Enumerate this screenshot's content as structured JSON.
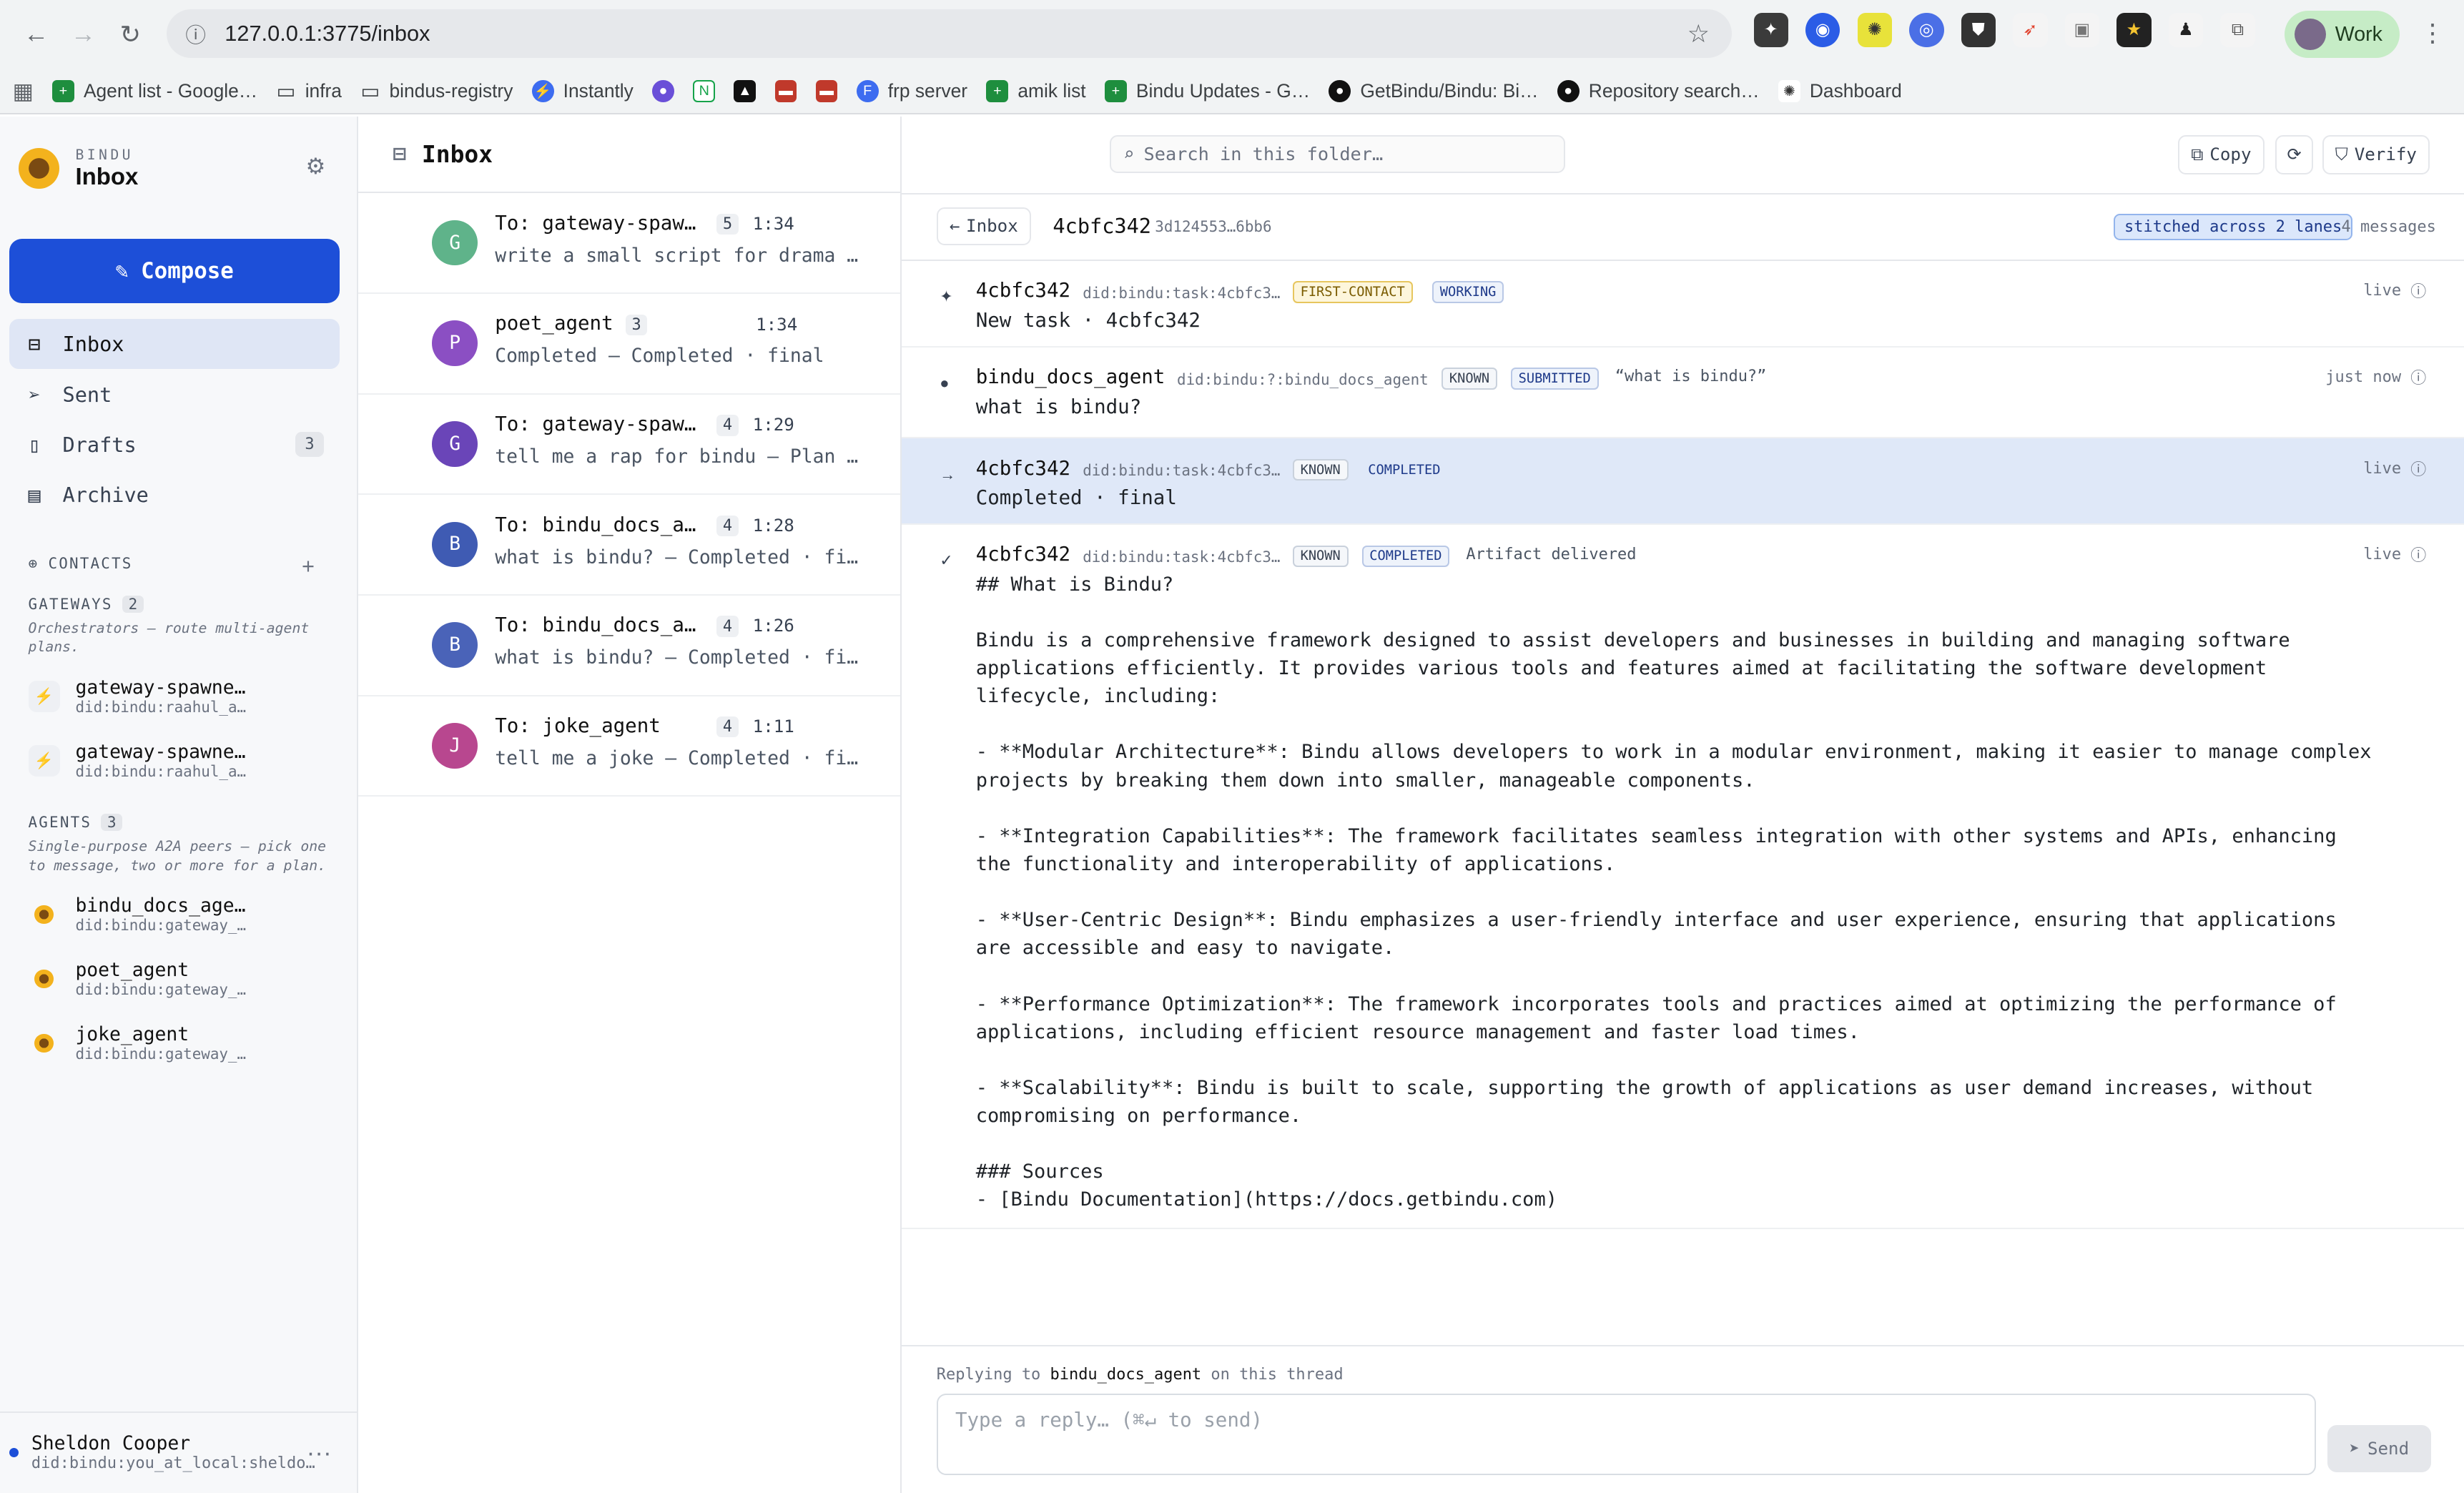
{
  "browser": {
    "url": "127.0.0.1:3775/inbox",
    "profile": "Work",
    "bookmarks": [
      "Agent list - Google…",
      "infra",
      "bindus-registry",
      "Instantly",
      "",
      "",
      "",
      "",
      "",
      "frp server",
      "amik list",
      "Bindu Updates - G…",
      "GetBindu/Bindu: Bi…",
      "Repository search…",
      "Dashboard"
    ]
  },
  "sidebar": {
    "brand_small": "BINDU",
    "brand_big": "Inbox",
    "compose": "Compose",
    "folders": [
      {
        "label": "Inbox",
        "count": ""
      },
      {
        "label": "Sent",
        "count": ""
      },
      {
        "label": "Drafts",
        "count": "3"
      },
      {
        "label": "Archive",
        "count": ""
      }
    ],
    "contacts_label": "CONTACTS",
    "gateways_label": "GATEWAYS",
    "gateways_count": "2",
    "gateways_hint": "Orchestrators — route multi-agent plans.",
    "gateways": [
      {
        "name": "gateway-spawne…",
        "did": "did:bindu:raahul_a…"
      },
      {
        "name": "gateway-spawne…",
        "did": "did:bindu:raahul_a…"
      }
    ],
    "agents_label": "AGENTS",
    "agents_count": "3",
    "agents_hint": "Single-purpose A2A peers — pick one to message, two or more for a plan.",
    "agents": [
      {
        "name": "bindu_docs_age…",
        "did": "did:bindu:gateway_…"
      },
      {
        "name": "poet_agent",
        "did": "did:bindu:gateway_…"
      },
      {
        "name": "joke_agent",
        "did": "did:bindu:gateway_…"
      }
    ],
    "user": {
      "name": "Sheldon Cooper",
      "did": "did:bindu:you_at_local:sheldo…"
    }
  },
  "list": {
    "title": "Inbox",
    "rows": [
      {
        "initial": "G",
        "to": "To: gateway-spawn…",
        "count": "5",
        "time": "1:34",
        "preview": "write a small script for drama — P…",
        "color": "#5fb38a"
      },
      {
        "initial": "P",
        "to": "poet_agent",
        "count": "3",
        "time": "1:34",
        "preview": "Completed — Completed · final",
        "color": "#8b4fc3"
      },
      {
        "initial": "G",
        "to": "To: gateway-spawn…",
        "count": "4",
        "time": "1:29",
        "preview": "tell me a rap for bindu — Plan ans…",
        "color": "#6a45b8"
      },
      {
        "initial": "B",
        "to": "To: bindu_docs_ag…",
        "count": "4",
        "time": "1:28",
        "preview": "what is bindu? — Completed · final",
        "color": "#3f5bb3"
      },
      {
        "initial": "B",
        "to": "To: bindu_docs_ag…",
        "count": "4",
        "time": "1:26",
        "preview": "what is bindu? — Completed · final",
        "color": "#4a63b8"
      },
      {
        "initial": "J",
        "to": "To: joke_agent",
        "count": "4",
        "time": "1:11",
        "preview": "tell me a joke — Completed · final",
        "color": "#b8478f"
      }
    ]
  },
  "main": {
    "search_placeholder": "Search in this folder…",
    "copy": "Copy",
    "verify": "Verify",
    "back": "Inbox",
    "thread_id": "4cbfc342",
    "thread_hash": "3d124553…6bb6",
    "stitched": "stitched across 2 lanes",
    "messages_count": "4 messages",
    "messages": [
      {
        "glyph": "✦",
        "sender": "4cbfc342",
        "did": "did:bindu:task:4cbfc3…",
        "tags": [
          "FIRST-CONTACT",
          "WORKING"
        ],
        "extra": "",
        "status": "live",
        "body": "New task · 4cbfc342"
      },
      {
        "glyph": "●",
        "sender": "bindu_docs_agent",
        "did": "did:bindu:?:bindu_docs_agent",
        "tags": [
          "KNOWN",
          "SUBMITTED"
        ],
        "extra": "“what is bindu?”",
        "status": "just now",
        "body": "what is bindu?"
      },
      {
        "glyph": "→",
        "sender": "4cbfc342",
        "did": "did:bindu:task:4cbfc3…",
        "tags": [
          "KNOWN",
          "COMPLETED"
        ],
        "extra": "",
        "status": "live",
        "body": "Completed · final"
      },
      {
        "glyph": "✓",
        "sender": "4cbfc342",
        "did": "did:bindu:task:4cbfc3…",
        "tags": [
          "KNOWN",
          "COMPLETED"
        ],
        "extra": "Artifact delivered",
        "status": "live",
        "body": ""
      }
    ],
    "artifact": [
      "## What is Bindu?",
      "",
      "Bindu is a comprehensive framework designed to assist developers and businesses in building and managing software applications efficiently. It provides various tools and features aimed at facilitating the software development lifecycle, including:",
      "",
      "- **Modular Architecture**: Bindu allows developers to work in a modular environment, making it easier to manage complex projects by breaking them down into smaller, manageable components.",
      "",
      "- **Integration Capabilities**: The framework facilitates seamless integration with other systems and APIs, enhancing the functionality and interoperability of applications.",
      "",
      "- **User-Centric Design**: Bindu emphasizes a user-friendly interface and user experience, ensuring that applications are accessible and easy to navigate.",
      "",
      "- **Performance Optimization**: The framework incorporates tools and practices aimed at optimizing the performance of applications, including efficient resource management and faster load times.",
      "",
      "- **Scalability**: Bindu is built to scale, supporting the growth of applications as user demand increases, without compromising on performance.",
      "",
      "### Sources",
      "- [Bindu Documentation](https://docs.getbindu.com)"
    ],
    "reply": {
      "prefix": "Replying to",
      "agent": "bindu_docs_agent",
      "suffix": "on this thread",
      "placeholder": "Type a reply… (⌘↵ to send)",
      "send": "Send"
    }
  }
}
